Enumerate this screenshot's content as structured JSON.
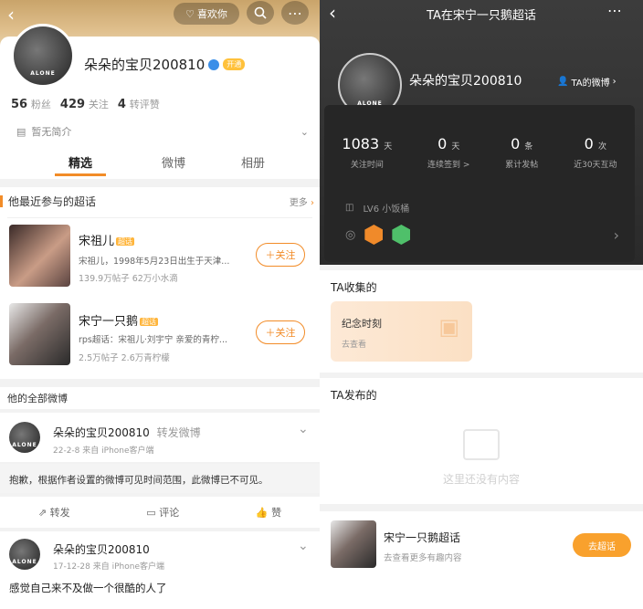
{
  "left": {
    "top_buttons": {
      "like_label": "喜欢你"
    },
    "profile": {
      "name": "朵朵的宝贝200810",
      "vip_badge": "开通",
      "avatar_text": "ALONE",
      "fans_count": "56",
      "fans_label": "粉丝",
      "following_count": "429",
      "following_label": "关注",
      "reposts_count": "4",
      "reposts_label": "转评赞",
      "intro": "暂无简介"
    },
    "tabs": [
      {
        "label": "精选",
        "active": true
      },
      {
        "label": "微博",
        "active": false
      },
      {
        "label": "相册",
        "active": false
      }
    ],
    "recent_supertopics": {
      "title": "他最近参与的超话",
      "more_label": "更多",
      "items": [
        {
          "name": "宋祖儿",
          "tag": "超话",
          "desc": "宋祖儿，1998年5月23日出生于天津...",
          "stats": "139.9万帖子 62万小水滴",
          "follow_label": "＋关注"
        },
        {
          "name": "宋宁一只鹅",
          "tag": "超话",
          "desc": "rps超话：宋祖儿·刘宇宁 亲爱的青柠...",
          "stats": "2.5万帖子 2.6万青柠檬",
          "follow_label": "＋关注"
        }
      ]
    },
    "all_weibo": {
      "title": "他的全部微博",
      "posts": [
        {
          "author": "朵朵的宝贝200810",
          "action": "转发微博",
          "date": "22-2-8",
          "source": "来自 iPhone客户端",
          "content": "抱歉，根据作者设置的微博可见时间范围，此微博已不可见。",
          "repost_label": "转发",
          "comment_label": "评论",
          "like_label": "赞"
        },
        {
          "author": "朵朵的宝贝200810",
          "action": "",
          "date": "17-12-28",
          "source": "来自 iPhone客户端",
          "content": "感觉自己来不及做一个很酷的人了"
        }
      ]
    }
  },
  "right": {
    "title": "TA在宋宁一只鹅超话",
    "profile": {
      "name": "朵朵的宝贝200810",
      "link_label": "TA的微博",
      "avatar_text": "ALONE"
    },
    "stats": [
      {
        "value": "1083",
        "unit": "天",
        "label": "关注时间"
      },
      {
        "value": "0",
        "unit": "天",
        "label": "连续签到 >"
      },
      {
        "value": "0",
        "unit": "条",
        "label": "累计发帖"
      },
      {
        "value": "0",
        "unit": "次",
        "label": "近30天互动"
      }
    ],
    "level": "LV6 小饭桶",
    "collected": {
      "title": "TA收集的",
      "card_title": "纪念时刻",
      "card_sub": "去查看"
    },
    "published": {
      "title": "TA发布的",
      "empty_text": "这里还没有内容"
    },
    "bottom": {
      "name": "宋宁一只鹅超话",
      "sub": "去查看更多有趣内容",
      "button": "去超话"
    }
  },
  "colors": {
    "accent": "#f28c28",
    "dark_bg": "#2b2b2b"
  }
}
